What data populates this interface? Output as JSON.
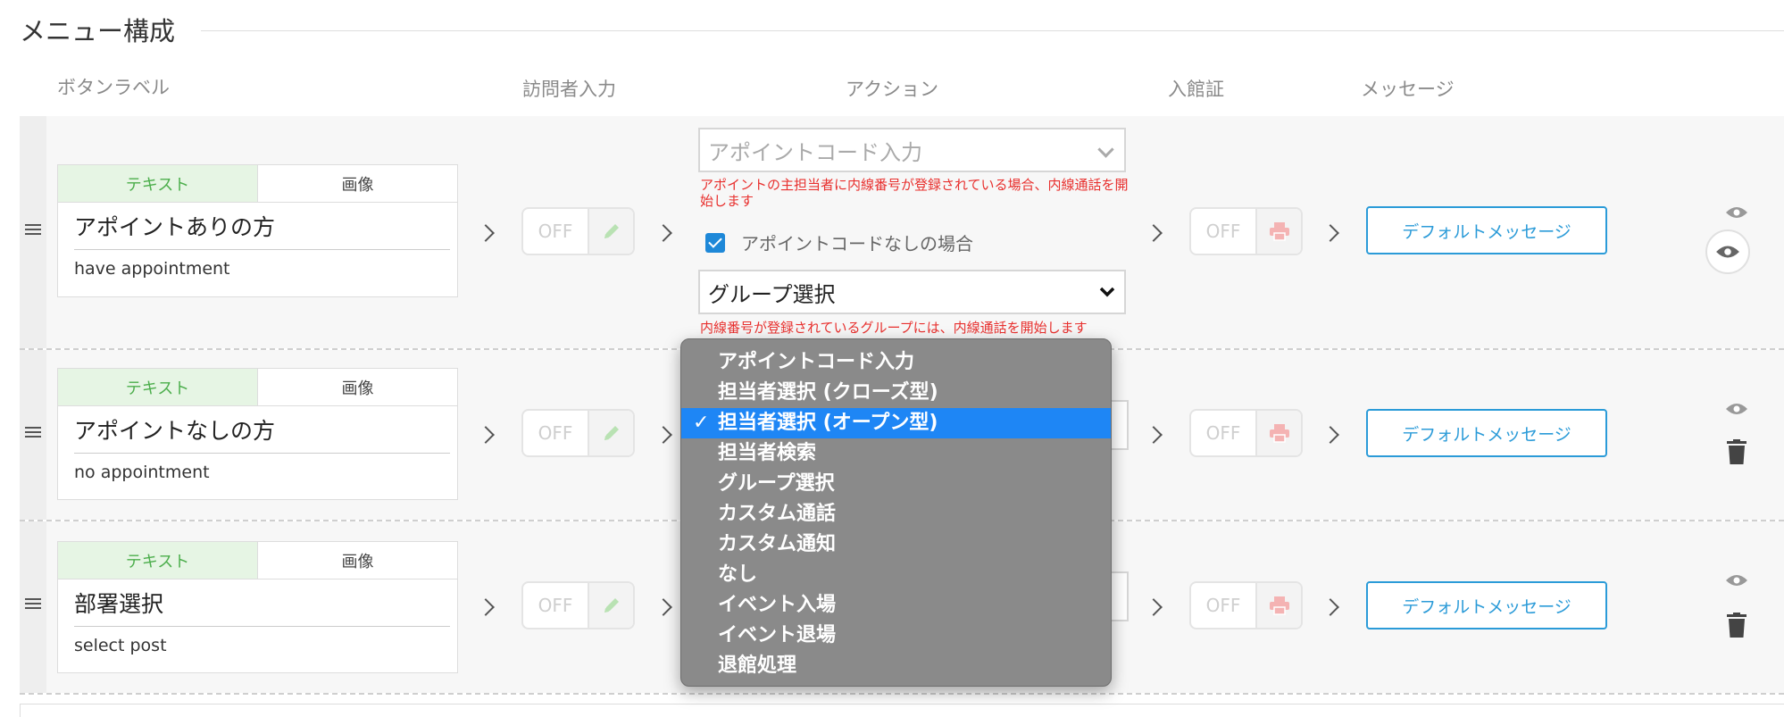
{
  "section": {
    "title": "メニュー構成"
  },
  "columns": {
    "button_label": "ボタンラベル",
    "visitor_input": "訪問者入力",
    "action": "アクション",
    "pass": "入館証",
    "message": "メッセージ"
  },
  "common": {
    "tab_text": "テキスト",
    "tab_image": "画像",
    "off": "OFF",
    "default_message": "デフォルトメッセージ"
  },
  "rows": [
    {
      "label_main": "アポイントありの方",
      "label_sub": "have appointment",
      "action_select": "アポイントコード入力",
      "action_note": "アポイントの主担当者に内線番号が登録されている場合、内線通話を開始します",
      "checkbox_label": "アポイントコードなしの場合",
      "checkbox_checked": true,
      "group_select": "グループ選択",
      "group_note": "内線番号が登録されているグループには、内線通話を開始します"
    },
    {
      "label_main": "アポイントなしの方",
      "label_sub": "no appointment"
    },
    {
      "label_main": "部署選択",
      "label_sub": "select post"
    }
  ],
  "dropdown": {
    "selected_index": 2,
    "options": [
      "アポイントコード入力",
      "担当者選択 (クローズ型)",
      "担当者選択 (オープン型)",
      "担当者検索",
      "グループ選択",
      "カスタム通話",
      "カスタム通知",
      "なし",
      "イベント入場",
      "イベント退場",
      "退館処理"
    ],
    "check_glyph": "✓"
  },
  "colors": {
    "accent_blue": "#2b9bd8",
    "tab_active_green": "#4cae4c",
    "note_red": "#e8302e",
    "dropdown_bg": "#8a8a8a",
    "dropdown_selected": "#1e86f5"
  }
}
